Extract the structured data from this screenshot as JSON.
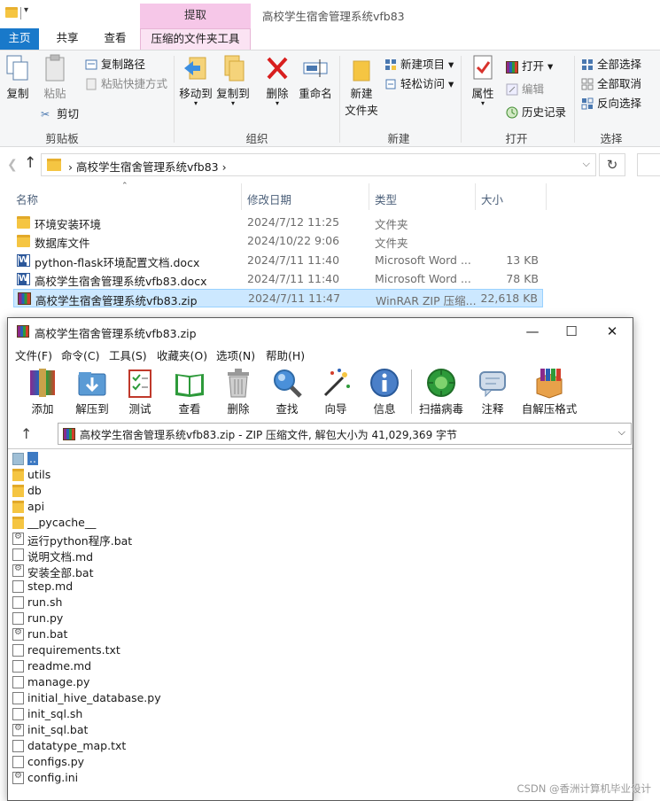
{
  "explorer": {
    "window_title": "高校学生宿舍管理系统vfb83",
    "context_tab_header": "提取",
    "tabs": [
      "主页",
      "共享",
      "查看",
      "压缩的文件夹工具"
    ],
    "ribbon": {
      "clipboard": {
        "copy": "复制",
        "paste": "粘贴",
        "copy_path": "复制路径",
        "paste_shortcut": "粘贴快捷方式",
        "cut": "剪切",
        "label": "剪贴板"
      },
      "organize": {
        "move_to": "移动到",
        "copy_to": "复制到",
        "delete": "删除",
        "rename": "重命名",
        "label": "组织"
      },
      "new": {
        "new_folder": "新建\n文件夹",
        "new_folder_l1": "新建",
        "new_folder_l2": "文件夹",
        "new_item": "新建项目",
        "easy_access": "轻松访问",
        "label": "新建"
      },
      "open": {
        "properties": "属性",
        "open": "打开",
        "edit": "编辑",
        "history": "历史记录",
        "label": "打开"
      },
      "select": {
        "select_all": "全部选择",
        "select_none": "全部取消",
        "invert": "反向选择",
        "label": "选择"
      }
    },
    "address": "高校学生宿舍管理系统vfb83",
    "columns": {
      "name": "名称",
      "date": "修改日期",
      "type": "类型",
      "size": "大小"
    },
    "files": [
      {
        "name": "环境安装环境",
        "date": "2024/7/12 11:25",
        "type": "文件夹",
        "size": "",
        "icon": "folder"
      },
      {
        "name": "数据库文件",
        "date": "2024/10/22 9:06",
        "type": "文件夹",
        "size": "",
        "icon": "folder"
      },
      {
        "name": "python-flask环境配置文档.docx",
        "date": "2024/7/11 11:40",
        "type": "Microsoft Word ...",
        "size": "13 KB",
        "icon": "word"
      },
      {
        "name": "高校学生宿舍管理系统vfb83.docx",
        "date": "2024/7/11 11:40",
        "type": "Microsoft Word ...",
        "size": "78 KB",
        "icon": "word"
      },
      {
        "name": "高校学生宿舍管理系统vfb83.zip",
        "date": "2024/7/11 11:47",
        "type": "WinRAR ZIP 压缩...",
        "size": "22,618 KB",
        "icon": "rar"
      }
    ]
  },
  "winrar": {
    "title": "高校学生宿舍管理系统vfb83.zip",
    "menu": [
      "文件(F)",
      "命令(C)",
      "工具(S)",
      "收藏夹(O)",
      "选项(N)",
      "帮助(H)"
    ],
    "toolbar": [
      "添加",
      "解压到",
      "测试",
      "查看",
      "删除",
      "查找",
      "向导",
      "信息",
      "扫描病毒",
      "注释",
      "自解压格式"
    ],
    "path": "高校学生宿舍管理系统vfb83.zip - ZIP 压缩文件, 解包大小为 41,029,369 字节",
    "entries": [
      {
        "name": "..",
        "icon": "up"
      },
      {
        "name": "utils",
        "icon": "folder"
      },
      {
        "name": "db",
        "icon": "folder"
      },
      {
        "name": "api",
        "icon": "folder"
      },
      {
        "name": "__pycache__",
        "icon": "folder"
      },
      {
        "name": "运行python程序.bat",
        "icon": "bat"
      },
      {
        "name": "说明文档.md",
        "icon": "file"
      },
      {
        "name": "安装全部.bat",
        "icon": "bat"
      },
      {
        "name": "step.md",
        "icon": "file"
      },
      {
        "name": "run.sh",
        "icon": "file"
      },
      {
        "name": "run.py",
        "icon": "file"
      },
      {
        "name": "run.bat",
        "icon": "bat"
      },
      {
        "name": "requirements.txt",
        "icon": "file"
      },
      {
        "name": "readme.md",
        "icon": "file"
      },
      {
        "name": "manage.py",
        "icon": "file"
      },
      {
        "name": "initial_hive_database.py",
        "icon": "file"
      },
      {
        "name": "init_sql.sh",
        "icon": "file"
      },
      {
        "name": "init_sql.bat",
        "icon": "bat"
      },
      {
        "name": "datatype_map.txt",
        "icon": "file"
      },
      {
        "name": "configs.py",
        "icon": "file"
      },
      {
        "name": "config.ini",
        "icon": "bat"
      }
    ]
  },
  "watermark": "CSDN @香洲计算机毕业设计"
}
